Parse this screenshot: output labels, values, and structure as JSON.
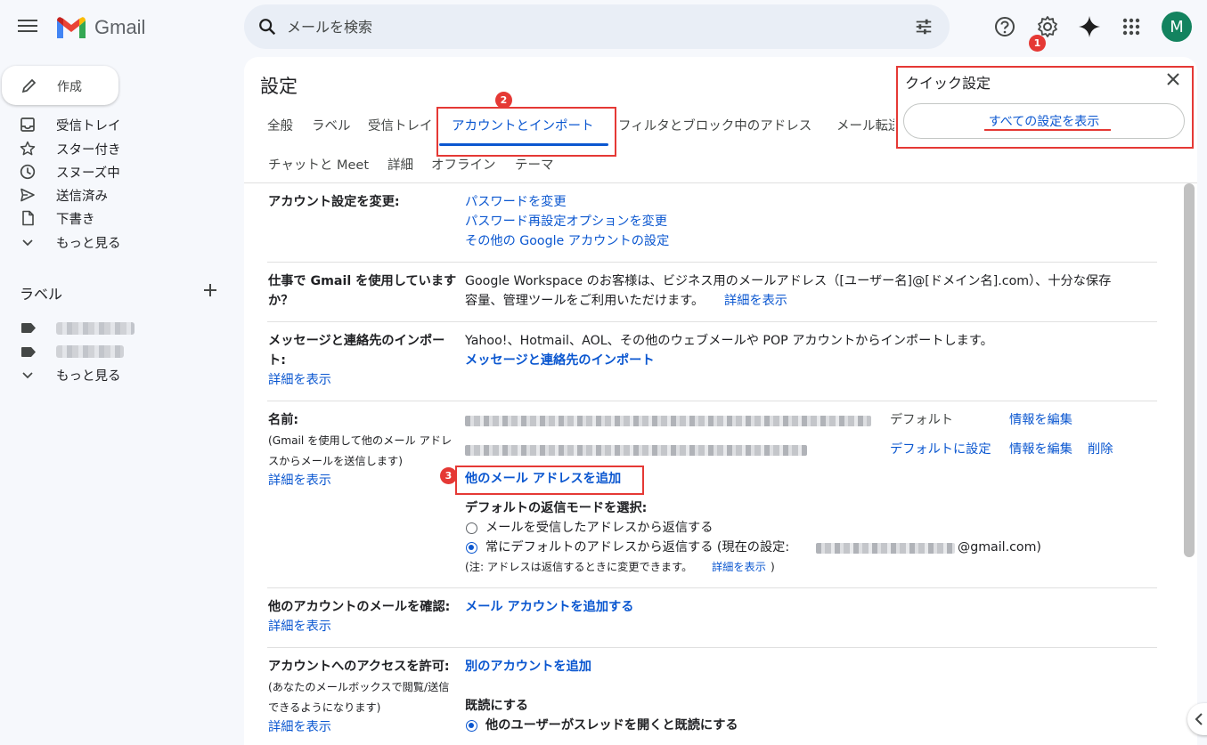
{
  "app": {
    "name": "Gmail",
    "avatar_letter": "M"
  },
  "search": {
    "placeholder": "メールを検索"
  },
  "steps": {
    "s1": "1",
    "s2": "2",
    "s3": "3"
  },
  "sidebar": {
    "compose": "作成",
    "items": [
      {
        "label": "受信トレイ",
        "icon": "inbox-icon"
      },
      {
        "label": "スター付き",
        "icon": "star-icon"
      },
      {
        "label": "スヌーズ中",
        "icon": "clock-icon"
      },
      {
        "label": "送信済み",
        "icon": "send-icon"
      },
      {
        "label": "下書き",
        "icon": "file-icon"
      },
      {
        "label": "もっと見る",
        "icon": "chevron-down-icon"
      }
    ],
    "labels_title": "ラベル",
    "labels_more": "もっと見る"
  },
  "settings": {
    "title": "設定",
    "tabs": [
      "全般",
      "ラベル",
      "受信トレイ",
      "アカウントとインポート",
      "フィルタとブロック中のアドレス",
      "メール転送"
    ],
    "tabs2": [
      "チャットと Meet",
      "詳細",
      "オフライン",
      "テーマ"
    ],
    "account": {
      "label": "アカウント設定を変更:",
      "links": [
        "パスワードを変更",
        "パスワード再設定オプションを変更",
        "その他の Google アカウントの設定"
      ]
    },
    "workspace": {
      "label1": "仕事で Gmail を使用しています",
      "label2": "か？",
      "text1": "Google Workspace のお客様は、ビジネス用のメールアドレス（[ユーザー名]@[ドメイン名].com）、十分な保存",
      "text2": "容量、管理ツールをご利用いただけます。",
      "link": "詳細を表示"
    },
    "import": {
      "label1": "メッセージと連絡先のインポー",
      "label2": "ト:",
      "link_detail": "詳細を表示",
      "text": "Yahoo!、Hotmail、AOL、その他のウェブメールや POP アカウントからインポートします。",
      "action": "メッセージと連絡先のインポート"
    },
    "name": {
      "label": "名前:",
      "sub1": "(Gmail を使用して他のメール アドレ",
      "sub2": "スからメールを送信します)",
      "link_detail": "詳細を表示",
      "default": "デフォルト",
      "edit": "情報を編集",
      "set_default": "デフォルトに設定",
      "edit2": "情報を編集",
      "delete": "削除",
      "add_address": "他のメール アドレスを追加",
      "reply_title": "デフォルトの返信モードを選択:",
      "reply_opt1": "メールを受信したアドレスから返信する",
      "reply_opt2": "常にデフォルトのアドレスから返信する (現在の設定:",
      "reply_email_suffix": "@gmail.com)",
      "note": "(注: アドレスは返信するときに変更できます。",
      "note_link": "詳細を表示",
      "note_end": ")"
    },
    "check_mail": {
      "label": "他のアカウントのメールを確認:",
      "link_detail": "詳細を表示",
      "action": "メール アカウントを追加する"
    },
    "grant": {
      "label": "アカウントへのアクセスを許可:",
      "sub1": "(あなたのメールボックスで閲覧/送信",
      "sub2": "できるようになります)",
      "link_detail": "詳細を表示",
      "action": "別のアカウントを追加",
      "read_title": "既読にする",
      "read_opt": "他のユーザーがスレッドを開くと既読にする"
    }
  },
  "quick_settings": {
    "title": "クイック設定",
    "button": "すべての設定を表示"
  },
  "colors": {
    "accent": "#0b57d0",
    "highlight": "#e53935",
    "avatar": "#13835f"
  }
}
